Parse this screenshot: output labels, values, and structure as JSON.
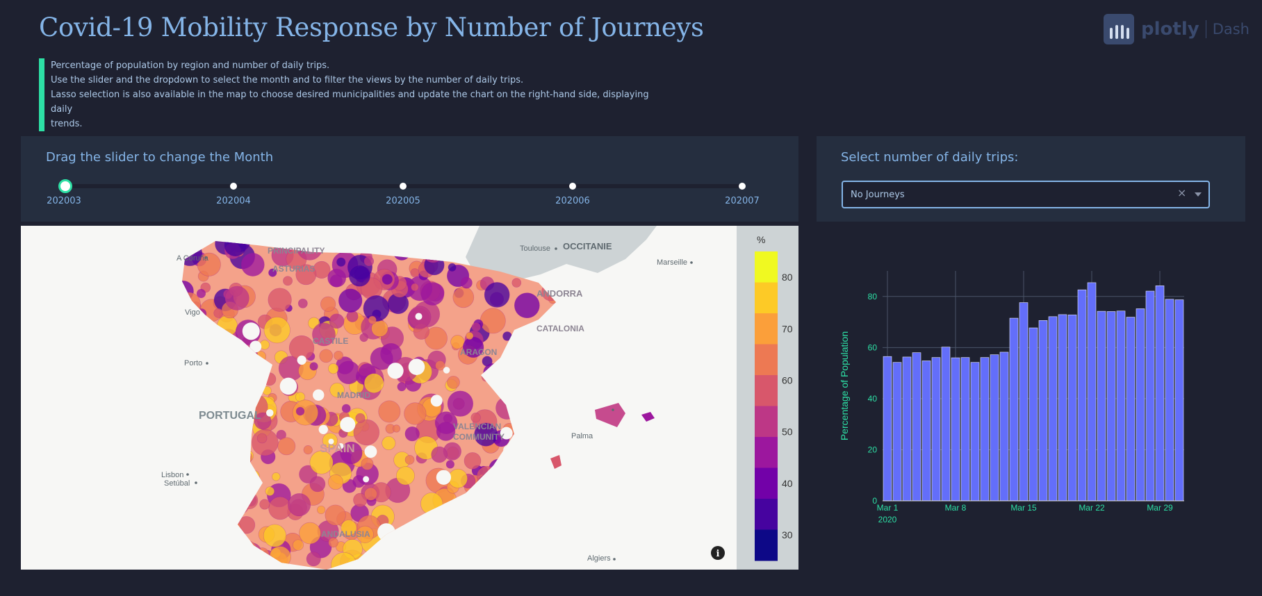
{
  "header": {
    "title": "Covid-19 Mobility Response by Number of Journeys",
    "brand_name": "plotly",
    "brand_sub": "Dash"
  },
  "description": [
    "Percentage of population by region and number of daily trips.",
    "Use the slider and the dropdown to select the month and to filter the views by the number of daily trips.",
    "Lasso selection is also available in the map to choose desired municipalities and update the chart on the right-hand side, displaying daily",
    "trends."
  ],
  "slider": {
    "label": "Drag the slider to change the Month",
    "marks": [
      "202003",
      "202004",
      "202005",
      "202006",
      "202007"
    ],
    "selected": "202003"
  },
  "dropdown": {
    "label": "Select number of daily trips:",
    "value": "No Journeys"
  },
  "map": {
    "places": [
      "Toulouse",
      "OCCITANIE",
      "Marseille",
      "A Coruña",
      "PRINCIPALITY",
      "ASTURIAS",
      "ANDORRA",
      "Vigo",
      "Porto",
      "PORTUGAL",
      "SPAIN",
      "Lisbon",
      "Setúbal",
      "Palma",
      "Algiers",
      "MADRID",
      "VALENCIAN",
      "COMMUNITY",
      "CATALONIA",
      "ARAGON",
      "CASTILE",
      "ANDALUSIA"
    ],
    "colorbar": {
      "title": "%",
      "ticks": [
        "80",
        "70",
        "60",
        "50",
        "40",
        "30"
      ],
      "colors": [
        "#f0f921",
        "#fdca26",
        "#fb9f3a",
        "#ed7953",
        "#d8576b",
        "#bd3786",
        "#9c179e",
        "#7201a8",
        "#46039f",
        "#0d0887"
      ]
    },
    "colors": {
      "land": "#f7f7f5",
      "sea": "#cdd3d5"
    }
  },
  "chart_data": {
    "type": "bar",
    "x": [
      "2020-03-01",
      "2020-03-02",
      "2020-03-03",
      "2020-03-04",
      "2020-03-05",
      "2020-03-06",
      "2020-03-07",
      "2020-03-08",
      "2020-03-09",
      "2020-03-10",
      "2020-03-11",
      "2020-03-12",
      "2020-03-13",
      "2020-03-14",
      "2020-03-15",
      "2020-03-16",
      "2020-03-17",
      "2020-03-18",
      "2020-03-19",
      "2020-03-20",
      "2020-03-21",
      "2020-03-22",
      "2020-03-23",
      "2020-03-24",
      "2020-03-25",
      "2020-03-26",
      "2020-03-27",
      "2020-03-28",
      "2020-03-29",
      "2020-03-30",
      "2020-03-31"
    ],
    "values": [
      56.5,
      54.2,
      56.3,
      58.0,
      54.8,
      56.1,
      60.2,
      56.0,
      56.1,
      54.2,
      56.1,
      57.2,
      58.2,
      71.5,
      77.6,
      67.7,
      70.6,
      72.1,
      72.9,
      72.8,
      82.6,
      85.4,
      74.2,
      74.1,
      74.3,
      71.9,
      75.2,
      82.1,
      84.2,
      78.9,
      78.7
    ],
    "xlabel": "",
    "ylabel": "Percentage of Population",
    "ylim": [
      0,
      90
    ],
    "y_ticks": [
      0,
      20,
      40,
      60,
      80
    ],
    "x_tick_dates": [
      "2020-03-01",
      "2020-03-08",
      "2020-03-15",
      "2020-03-22",
      "2020-03-29"
    ],
    "x_tick_labels": [
      "Mar 1",
      "Mar 8",
      "Mar 15",
      "Mar 22",
      "Mar 29"
    ],
    "x_tick_year": "2020",
    "bar_color": "#636efa",
    "grid": true
  }
}
